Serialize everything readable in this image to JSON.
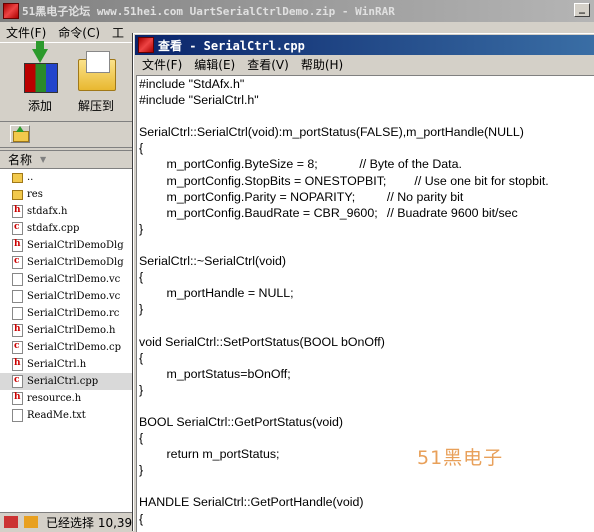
{
  "back_window": {
    "title": "51黑电子论坛 www.51hei.com UartSerialCtrlDemo.zip - WinRAR",
    "menu": [
      "文件(F)",
      "命令(C)",
      "工"
    ],
    "toolbar": [
      {
        "label": "添加",
        "icon": "add-archive-icon"
      },
      {
        "label": "解压到",
        "icon": "extract-icon"
      }
    ],
    "file_list": {
      "column_header": "名称",
      "items": [
        {
          "name": "..",
          "icon": "up-folder-icon"
        },
        {
          "name": "res",
          "icon": "folder-icon"
        },
        {
          "name": "stdafx.h",
          "icon": "h-file-icon"
        },
        {
          "name": "stdafx.cpp",
          "icon": "cpp-file-icon"
        },
        {
          "name": "SerialCtrlDemoDlg",
          "icon": "h-file-icon"
        },
        {
          "name": "SerialCtrlDemoDlg",
          "icon": "cpp-file-icon"
        },
        {
          "name": "SerialCtrlDemo.vc",
          "icon": "file-icon"
        },
        {
          "name": "SerialCtrlDemo.vc",
          "icon": "file-icon"
        },
        {
          "name": "SerialCtrlDemo.rc",
          "icon": "file-icon"
        },
        {
          "name": "SerialCtrlDemo.h",
          "icon": "h-file-icon"
        },
        {
          "name": "SerialCtrlDemo.cp",
          "icon": "cpp-file-icon"
        },
        {
          "name": "SerialCtrl.h",
          "icon": "h-file-icon"
        },
        {
          "name": "SerialCtrl.cpp",
          "icon": "cpp-file-icon",
          "selected": true
        },
        {
          "name": "resource.h",
          "icon": "h-file-icon"
        },
        {
          "name": "ReadMe.txt",
          "icon": "file-icon"
        }
      ]
    },
    "status": "已经选择 10,39"
  },
  "viewer": {
    "title": "查看 - SerialCtrl.cpp",
    "menu": [
      "文件(F)",
      "编辑(E)",
      "查看(V)",
      "帮助(H)"
    ],
    "code": "#include \"StdAfx.h\"\n#include \"SerialCtrl.h\"\n\nSerialCtrl::SerialCtrl(void):m_portStatus(FALSE),m_portHandle(NULL)\n{\n\tm_portConfig.ByteSize = 8;\t\t// Byte of the Data.\n\tm_portConfig.StopBits = ONESTOPBIT;\t// Use one bit for stopbit.\n\tm_portConfig.Parity = NOPARITY;\t\t// No parity bit\n\tm_portConfig.BaudRate = CBR_9600;\t// Buadrate 9600 bit/sec\n}\n\nSerialCtrl::~SerialCtrl(void)\n{\n\tm_portHandle = NULL;\n}\n\nvoid SerialCtrl::SetPortStatus(BOOL bOnOff)\n{\n\tm_portStatus=bOnOff;\n}\n\nBOOL SerialCtrl::GetPortStatus(void)\n{\n\treturn m_portStatus;\n}\n\nHANDLE SerialCtrl::GetPortHandle(void)\n{",
    "watermark": "51黑电子"
  }
}
